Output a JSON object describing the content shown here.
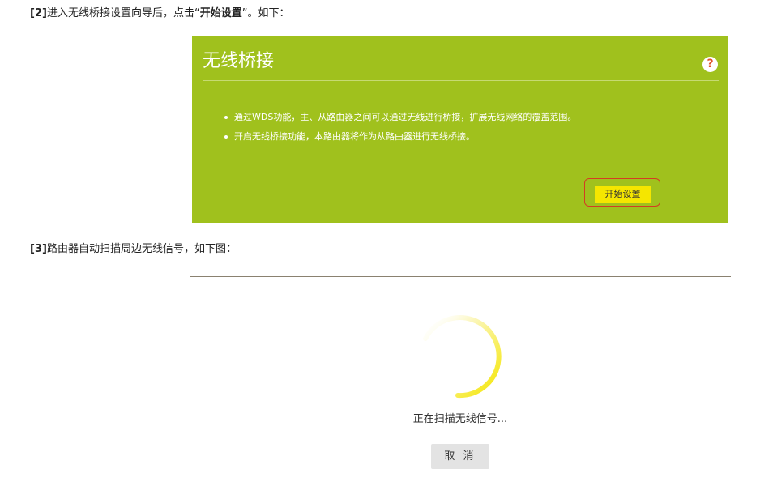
{
  "instructions": {
    "step1_prefix": "[2]",
    "step1_text": "进入无线桥接设置向导后，点击“",
    "step1_emphasis": "开始设置",
    "step1_suffix": "”。如下：",
    "step2_prefix": "[3]",
    "step2_text": "路由器自动扫描周边无线信号，如下图："
  },
  "bridge_panel": {
    "title": "无线桥接",
    "help_icon": "?",
    "bullets": [
      "通过WDS功能，主、从路由器之间可以通过无线进行桥接，扩展无线网络的覆盖范围。",
      "开启无线桥接功能，本路由器将作为从路由器进行无线桥接。"
    ],
    "start_button": "开始设置",
    "colors": {
      "panel_bg": "#a0c11d",
      "button_bg": "#f5e600",
      "highlight_border": "#d43d22"
    }
  },
  "scan": {
    "status_text": "正在扫描无线信号...",
    "cancel_button": "取 消",
    "spinner_icon": "loading-spinner-icon",
    "colors": {
      "spinner": "#f5e600"
    }
  }
}
